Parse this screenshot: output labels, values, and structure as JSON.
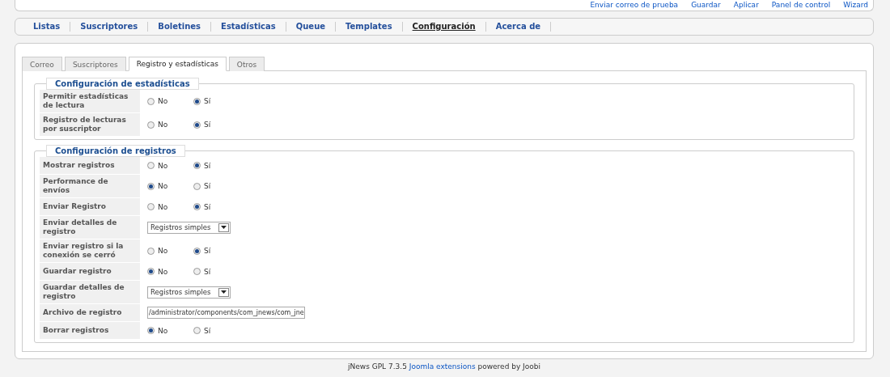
{
  "toolbar": [
    "Enviar correo de prueba",
    "Guardar",
    "Aplicar",
    "Panel de control",
    "Wizard"
  ],
  "nav": [
    {
      "label": "Listas",
      "selected": false
    },
    {
      "label": "Suscriptores",
      "selected": false
    },
    {
      "label": "Boletines",
      "selected": false
    },
    {
      "label": "Estadísticas",
      "selected": false
    },
    {
      "label": "Queue",
      "selected": false
    },
    {
      "label": "Templates",
      "selected": false
    },
    {
      "label": "Configuración",
      "selected": true
    },
    {
      "label": "Acerca de",
      "selected": false
    }
  ],
  "tabs": [
    {
      "label": "Correo",
      "selected": false
    },
    {
      "label": "Suscriptores",
      "selected": false
    },
    {
      "label": "Registro y estadísticas",
      "selected": true
    },
    {
      "label": "Otros",
      "selected": false
    }
  ],
  "sections": [
    {
      "legend": "Configuración de estadísticas",
      "rows": [
        {
          "kind": "radio",
          "label": "Permitir estadísticas de lectura",
          "options": [
            {
              "label": "No",
              "selected": false
            },
            {
              "label": "Sí",
              "selected": true
            }
          ]
        },
        {
          "kind": "radio",
          "label": "Registro de lecturas por suscriptor",
          "options": [
            {
              "label": "No",
              "selected": false
            },
            {
              "label": "Sí",
              "selected": true
            }
          ]
        }
      ]
    },
    {
      "legend": "Configuración de registros",
      "rows": [
        {
          "kind": "radio",
          "label": "Mostrar registros",
          "options": [
            {
              "label": "No",
              "selected": false
            },
            {
              "label": "Sí",
              "selected": true
            }
          ]
        },
        {
          "kind": "radio",
          "label": "Performance de envíos",
          "options": [
            {
              "label": "No",
              "selected": true
            },
            {
              "label": "Sí",
              "selected": false
            }
          ]
        },
        {
          "kind": "radio",
          "label": "Enviar Registro",
          "options": [
            {
              "label": "No",
              "selected": false
            },
            {
              "label": "Sí",
              "selected": true
            }
          ]
        },
        {
          "kind": "select",
          "label": "Enviar detalles de registro",
          "value": "Registros simples"
        },
        {
          "kind": "radio",
          "label": "Enviar registro si la conexión se cerró",
          "options": [
            {
              "label": "No",
              "selected": false
            },
            {
              "label": "Sí",
              "selected": true
            }
          ]
        },
        {
          "kind": "radio",
          "label": "Guardar registro",
          "options": [
            {
              "label": "No",
              "selected": true
            },
            {
              "label": "Sí",
              "selected": false
            }
          ]
        },
        {
          "kind": "select",
          "label": "Guardar detalles de registro",
          "value": "Registros simples"
        },
        {
          "kind": "text",
          "label": "Archivo de registro",
          "value": "/administrator/components/com_jnews/com_jne"
        },
        {
          "kind": "radio",
          "label": "Borrar registros",
          "options": [
            {
              "label": "No",
              "selected": true
            },
            {
              "label": "Sí",
              "selected": false
            }
          ]
        }
      ]
    }
  ],
  "footer": {
    "text": "jNews GPL 7.3.5",
    "link": "Joomla extensions",
    "suffix": "powered by Joobi"
  }
}
